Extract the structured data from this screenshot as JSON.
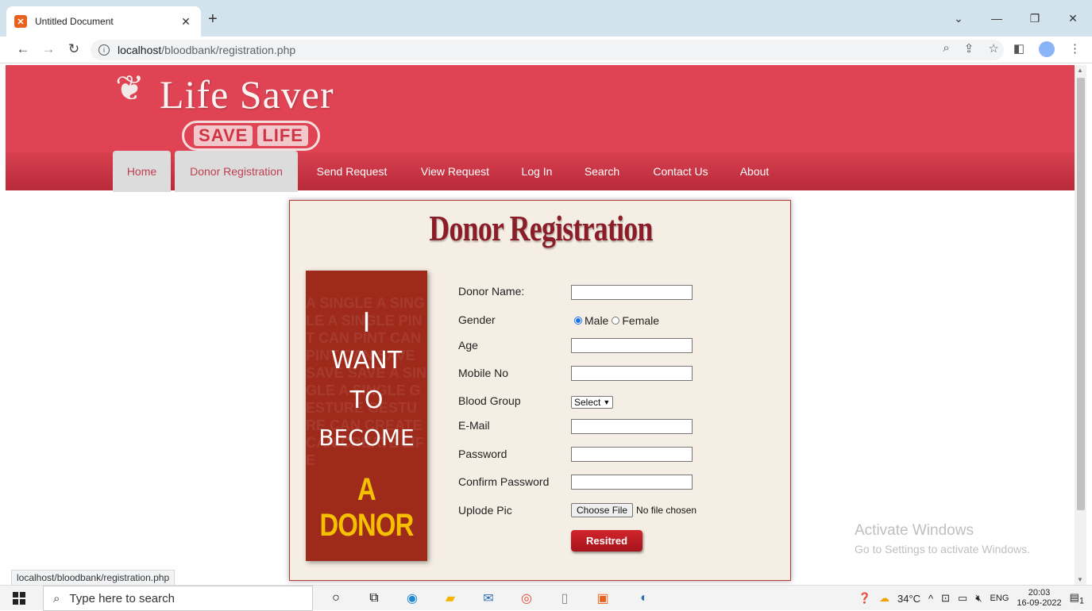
{
  "browser": {
    "tab_title": "Untitled Document",
    "url_host": "localhost",
    "url_path": "/bloodbank/registration.php",
    "status_url": "localhost/bloodbank/registration.php"
  },
  "site": {
    "logo_title": "Life Saver",
    "logo_tag_1": "SAVE",
    "logo_tag_2": "LIFE",
    "nav": [
      "Home",
      "Donor Registration",
      "Send Request",
      "View Request",
      "Log In",
      "Search",
      "Contact Us",
      "About"
    ]
  },
  "form": {
    "title": "Donor Registration",
    "labels": {
      "name": "Donor Name:",
      "gender": "Gender",
      "age": "Age",
      "mobile": "Mobile No",
      "blood": "Blood Group",
      "email": "E-Mail",
      "password": "Password",
      "confirm": "Confirm Password",
      "pic": "Uplode Pic"
    },
    "gender_options": [
      "Male",
      "Female"
    ],
    "gender_selected": "Male",
    "blood_select": "Select",
    "file_button": "Choose File",
    "file_status": "No file chosen",
    "submit": "Resitred"
  },
  "poster": {
    "lines": [
      "I",
      "WANT",
      "TO",
      "BECOME"
    ],
    "highlight": "A DONOR",
    "bg_text": "A SINGLE A SINGLE A SINGLE PINT CAN PINT CAN PINT CAN SAVE SAVE SAVE A SINGLE A SINGLE GESTURE GESTURE CAN CREATE CAN CREATE LIFE"
  },
  "watermark": {
    "title": "Activate Windows",
    "subtitle": "Go to Settings to activate Windows."
  },
  "taskbar": {
    "search_placeholder": "Type here to search",
    "temperature": "34°C",
    "lang": "ENG",
    "time": "20:03",
    "date": "16-09-2022",
    "notif_count": "1"
  },
  "colors": {
    "header": "#e04454",
    "title": "#8a1d28",
    "card_bg": "#f5eee4",
    "poster": "#9e2a1c",
    "poster_highlight": "#f5c000"
  }
}
